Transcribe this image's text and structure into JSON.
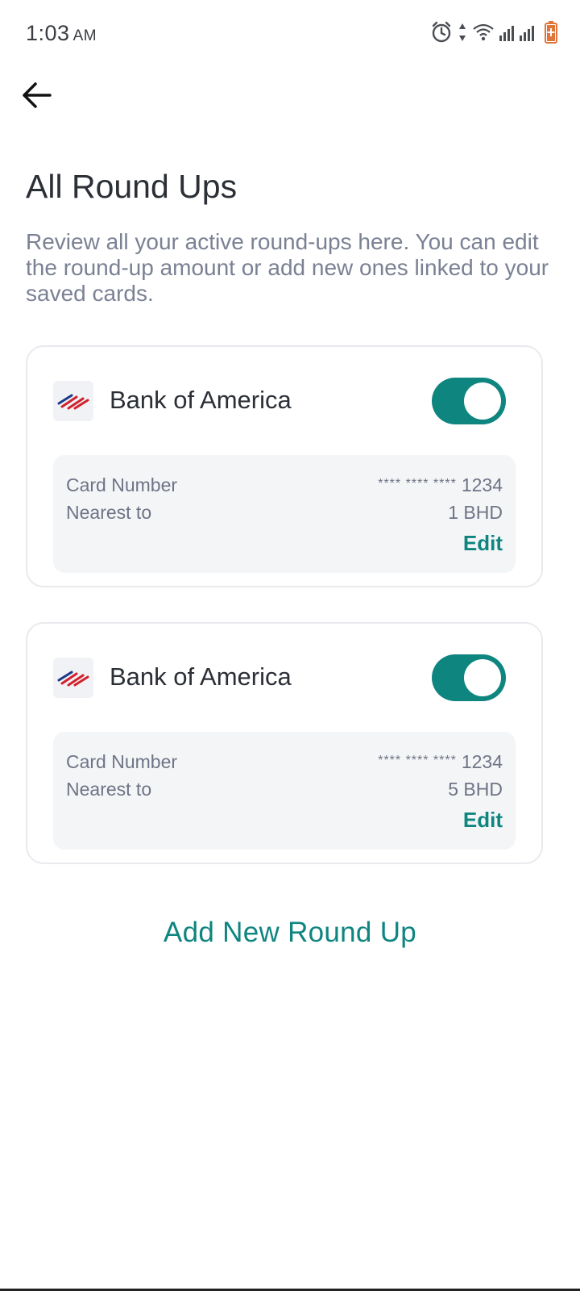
{
  "status": {
    "time": "1:03",
    "ampm": "AM"
  },
  "header": {
    "title": "All Round Ups",
    "description": "Review all your active round-ups here. You can edit the round-up amount or add new ones linked to your saved cards."
  },
  "cards": [
    {
      "bank": "Bank of America",
      "enabled": true,
      "card_label": "Card Number",
      "card_mask": "**** **** ****",
      "card_last4": "1234",
      "nearest_label": "Nearest to",
      "nearest_value": "1 BHD",
      "edit_label": "Edit"
    },
    {
      "bank": "Bank of America",
      "enabled": true,
      "card_label": "Card Number",
      "card_mask": "**** **** ****",
      "card_last4": "1234",
      "nearest_label": "Nearest to",
      "nearest_value": "5 BHD",
      "edit_label": "Edit"
    }
  ],
  "actions": {
    "add_label": "Add New Round Up"
  },
  "colors": {
    "accent": "#0f8580",
    "muted_text": "#7b8194",
    "title_text": "#2b2f36",
    "panel_bg": "#f4f5f7"
  },
  "icons": [
    "alarm-icon",
    "data-arrows-icon",
    "wifi-icon",
    "signal-icon",
    "battery-icon",
    "back-arrow-icon",
    "bank-of-america-logo"
  ]
}
